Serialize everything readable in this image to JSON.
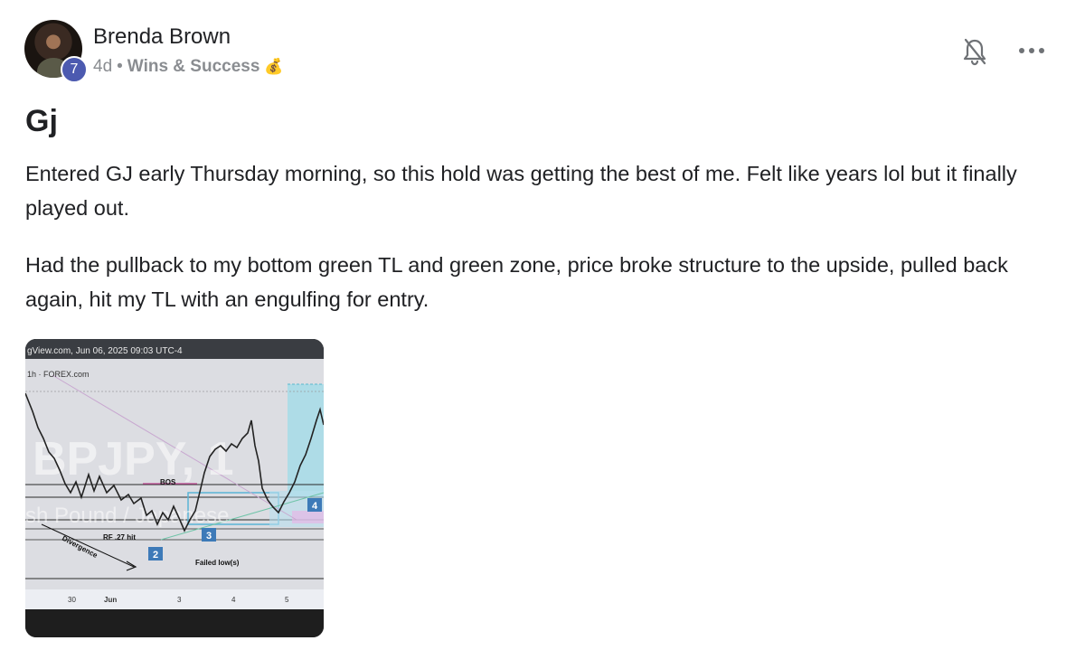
{
  "post": {
    "author": "Brenda Brown",
    "level": "7",
    "age": "4d",
    "separator": "•",
    "category": "Wins & Success",
    "category_emoji": "💰",
    "title": "Gj",
    "paragraphs": [
      "Entered GJ early Thursday morning, so this hold was getting the best of me. Felt like years lol but it finally played out.",
      "Had the pullback to my bottom green TL and green zone, price broke structure to the upside, pulled back again, hit my TL with an engulfing for entry."
    ],
    "actions": {
      "notify_icon": "bell-off-icon",
      "more_icon": "more-horizontal-icon"
    }
  },
  "attachment": {
    "header_text": "gView.com, Jun 06, 2025 09:03 UTC-4",
    "sub_text": "1h · FOREX.com",
    "watermark_line1": "BPJPY, 1",
    "watermark_line2": "sh Pound / Japanese",
    "annotations": {
      "bos": "BOS",
      "rf": "RF .27 hit",
      "divergence": "Divergence",
      "failed_low": "Failed low(s)",
      "box2": "2",
      "box3": "3",
      "box4": "4"
    },
    "x_labels": [
      "30",
      "Jun",
      "3",
      "4",
      "5"
    ]
  }
}
